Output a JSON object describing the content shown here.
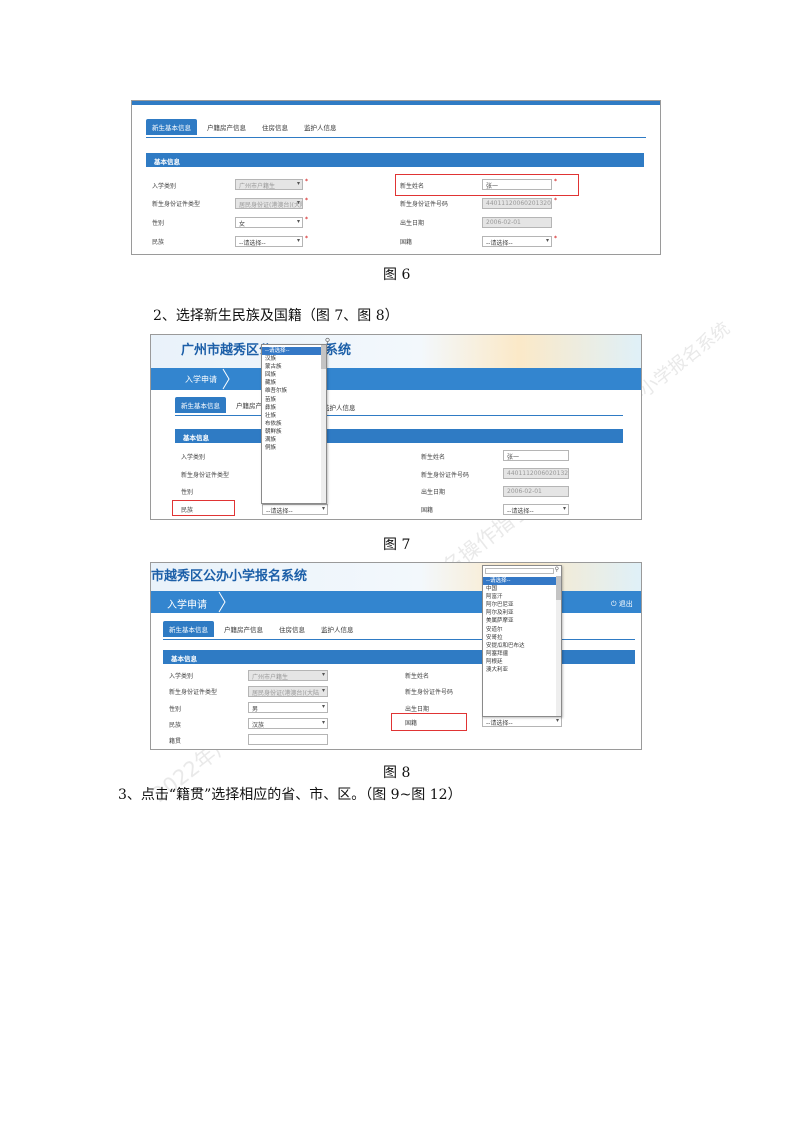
{
  "captions": {
    "fig6": "图 6",
    "fig7": "图 7",
    "fig8": "图 8"
  },
  "paragraphs": {
    "step2": "2、选择新生民族及国籍（图 7、图 8）",
    "step3": "3、点击“籍贯”选择相应的省、市、区。（图 9~图 12）"
  },
  "watermark": {
    "line1": "2022年广州市义务教育公办小学网上报名操作指引",
    "line2": "广州市越秀区公办小学报名系统"
  },
  "system_name": "市越秀区公办小学报名系统",
  "system_name_fig7_left": "广州市越秀区公",
  "system_name_fig7_right": "系统",
  "nav": {
    "apply": "入学申请",
    "logout": "退出"
  },
  "tabs": [
    "新生基本信息",
    "户籍房产信息",
    "住房信息",
    "监护人信息"
  ],
  "tabs_fig7": {
    "first": "新生基本信息",
    "partial_left": "户籍房产",
    "partial_right": "监护人信息"
  },
  "section_title": "基本信息",
  "form": {
    "labels": {
      "enroll_type": "入学类别",
      "id_type": "新生身份证件类型",
      "gender": "性别",
      "ethnicity": "民族",
      "name": "新生姓名",
      "id_no": "新生身份证件号码",
      "birth": "出生日期",
      "nationality": "国籍",
      "native_place": "籍贯"
    },
    "fig6": {
      "enroll_type": "广州市户籍生",
      "id_type": "居民身份证(港澳台)(大陆",
      "gender": "女",
      "ethnicity": "--请选择--",
      "name": "张一",
      "id_no": "440111200602013206",
      "birth": "2006-02-01",
      "nationality": "--请选择--"
    },
    "fig7": {
      "name": "张一",
      "id_no": "440111200602013206",
      "birth": "2006-02-01",
      "ethnicity": "--请选择--",
      "nationality": "--请选择--"
    },
    "fig8": {
      "enroll_type": "广州市户籍生",
      "id_type": "居民身份证(港澳台)(大陆",
      "gender": "男",
      "ethnicity": "汉族",
      "native_place": "",
      "nationality": "--请选择--"
    }
  },
  "ethnicity_options": [
    "--请选择--",
    "汉族",
    "蒙古族",
    "回族",
    "藏族",
    "维吾尔族",
    "苗族",
    "彝族",
    "壮族",
    "布依族",
    "朝鲜族",
    "满族",
    "侗族"
  ],
  "nationality_options": [
    "--请选择--",
    "中国",
    "阿富汗",
    "阿尔巴尼亚",
    "阿尔及利亚",
    "美属萨摩亚",
    "安道尔",
    "安哥拉",
    "安提瓜和巴布达",
    "阿塞拜疆",
    "阿根廷",
    "澳大利亚"
  ],
  "colors": {
    "accent": "#2f7bc4",
    "nav": "#3385cf",
    "highlight": "#e03434",
    "title": "#1c5fa8"
  }
}
